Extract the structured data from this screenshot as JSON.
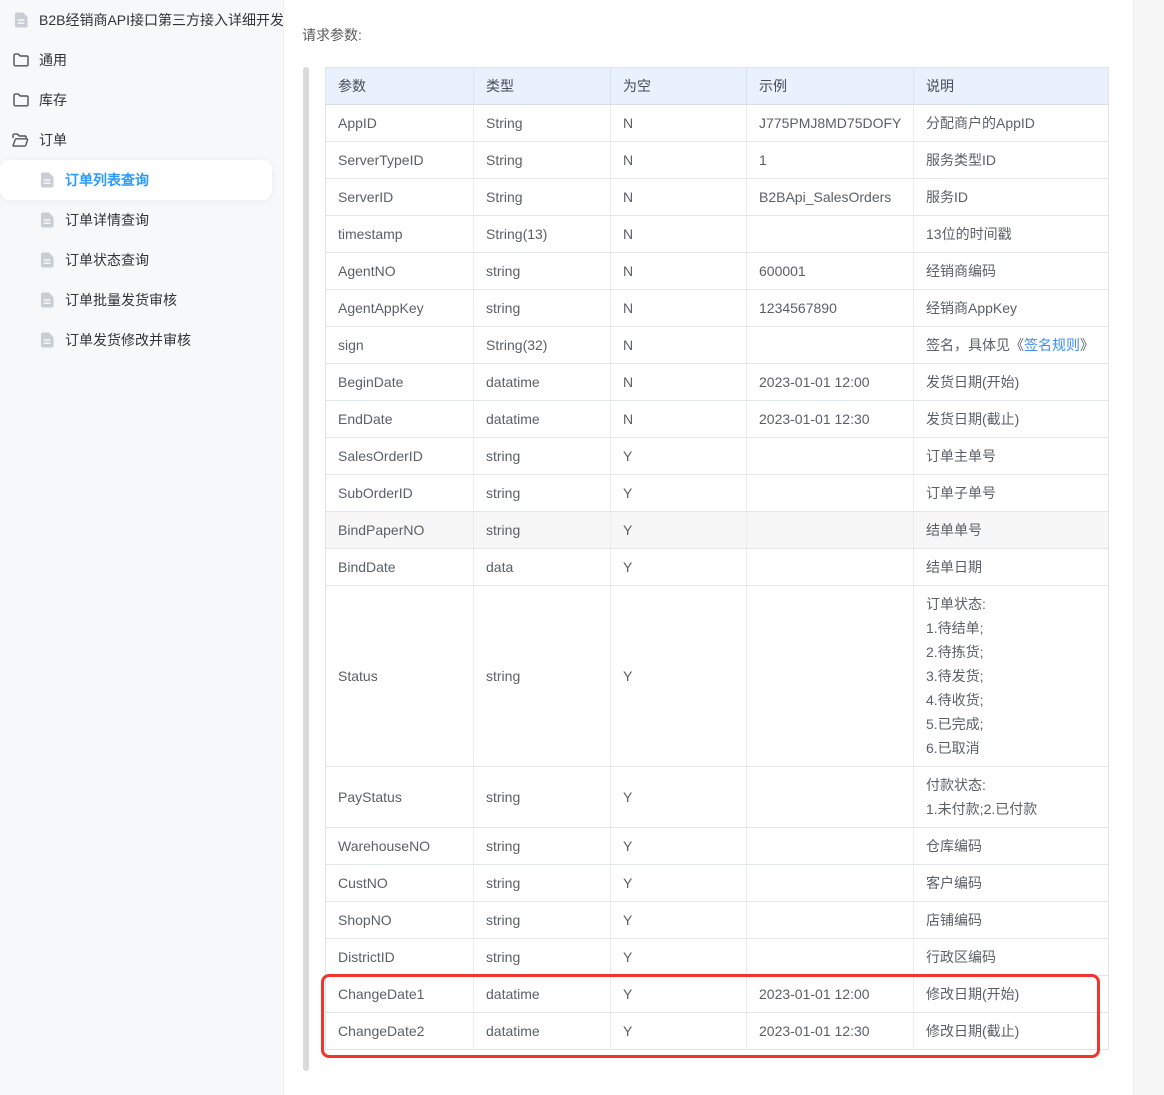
{
  "colors": {
    "accent_blue": "#2a9aff",
    "link_blue": "#3f8cf3",
    "annotation_red": "#f2352c",
    "header_bg": "#e9f1fc"
  },
  "sidebar": {
    "items": [
      {
        "label": "B2B经销商API接口第三方接入详细开发...",
        "icon": "document",
        "level": 0,
        "active": false
      },
      {
        "label": "通用",
        "icon": "folder",
        "level": 0,
        "active": false
      },
      {
        "label": "库存",
        "icon": "folder",
        "level": 0,
        "active": false
      },
      {
        "label": "订单",
        "icon": "folder-open",
        "level": 0,
        "active": false
      },
      {
        "label": "订单列表查询",
        "icon": "document",
        "level": 1,
        "active": true
      },
      {
        "label": "订单详情查询",
        "icon": "document",
        "level": 1,
        "active": false
      },
      {
        "label": "订单状态查询",
        "icon": "document",
        "level": 1,
        "active": false
      },
      {
        "label": "订单批量发货审核",
        "icon": "document",
        "level": 1,
        "active": false
      },
      {
        "label": "订单发货修改并审核",
        "icon": "document",
        "level": 1,
        "active": false
      }
    ]
  },
  "content": {
    "section_label": "请求参数:",
    "table": {
      "headers": [
        "参数",
        "类型",
        "为空",
        "示例",
        "说明"
      ],
      "rows": [
        {
          "param": "AppID",
          "type": "String",
          "nullable": "N",
          "example": "J775PMJ8MD75DOFY",
          "desc": [
            "分配商户的AppID"
          ]
        },
        {
          "param": "ServerTypeID",
          "type": "String",
          "nullable": "N",
          "example": "1",
          "desc": [
            "服务类型ID"
          ]
        },
        {
          "param": "ServerID",
          "type": "String",
          "nullable": "N",
          "example": "B2BApi_SalesOrders",
          "desc": [
            "服务ID"
          ]
        },
        {
          "param": "timestamp",
          "type": "String(13)",
          "nullable": "N",
          "example": "",
          "desc": [
            "13位的时间戳"
          ]
        },
        {
          "param": "AgentNO",
          "type": "string",
          "nullable": "N",
          "example": "600001",
          "desc": [
            "经销商编码"
          ]
        },
        {
          "param": "AgentAppKey",
          "type": "string",
          "nullable": "N",
          "example": "1234567890",
          "desc": [
            "经销商AppKey"
          ]
        },
        {
          "param": "sign",
          "type": "String(32)",
          "nullable": "N",
          "example": "",
          "desc": [
            {
              "pre": "签名，具体见《",
              "link": "签名规则",
              "post": "》"
            }
          ]
        },
        {
          "param": "BeginDate",
          "type": "datatime",
          "nullable": "N",
          "example": "2023-01-01 12:00",
          "desc": [
            "发货日期(开始)"
          ]
        },
        {
          "param": "EndDate",
          "type": "datatime",
          "nullable": "N",
          "example": "2023-01-01 12:30",
          "desc": [
            "发货日期(截止)"
          ]
        },
        {
          "param": "SalesOrderID",
          "type": "string",
          "nullable": "Y",
          "example": "",
          "desc": [
            "订单主单号"
          ]
        },
        {
          "param": "SubOrderID",
          "type": "string",
          "nullable": "Y",
          "example": "",
          "desc": [
            "订单子单号"
          ]
        },
        {
          "param": "BindPaperNO",
          "type": "string",
          "nullable": "Y",
          "example": "",
          "desc": [
            "结单单号"
          ],
          "shaded": true
        },
        {
          "param": "BindDate",
          "type": "data",
          "nullable": "Y",
          "example": "",
          "desc": [
            "结单日期"
          ]
        },
        {
          "param": "Status",
          "type": "string",
          "nullable": "Y",
          "example": "",
          "desc": [
            "订单状态:",
            "1.待结单;",
            "2.待拣货;",
            "3.待发货;",
            "4.待收货;",
            "5.已完成;",
            "6.已取消"
          ]
        },
        {
          "param": "PayStatus",
          "type": "string",
          "nullable": "Y",
          "example": "",
          "desc": [
            "付款状态:",
            "1.未付款;2.已付款"
          ]
        },
        {
          "param": "WarehouseNO",
          "type": "string",
          "nullable": "Y",
          "example": "",
          "desc": [
            "仓库编码"
          ]
        },
        {
          "param": "CustNO",
          "type": "string",
          "nullable": "Y",
          "example": "",
          "desc": [
            "客户编码"
          ]
        },
        {
          "param": "ShopNO",
          "type": "string",
          "nullable": "Y",
          "example": "",
          "desc": [
            "店铺编码"
          ]
        },
        {
          "param": "DistrictID",
          "type": "string",
          "nullable": "Y",
          "example": "",
          "desc": [
            "行政区编码"
          ]
        },
        {
          "param": "ChangeDate1",
          "type": "datatime",
          "nullable": "Y",
          "example": "2023-01-01 12:00",
          "desc": [
            "修改日期(开始)"
          ],
          "annotated": true
        },
        {
          "param": "ChangeDate2",
          "type": "datatime",
          "nullable": "Y",
          "example": "2023-01-01 12:30",
          "desc": [
            "修改日期(截止)"
          ],
          "annotated": true
        }
      ]
    }
  }
}
